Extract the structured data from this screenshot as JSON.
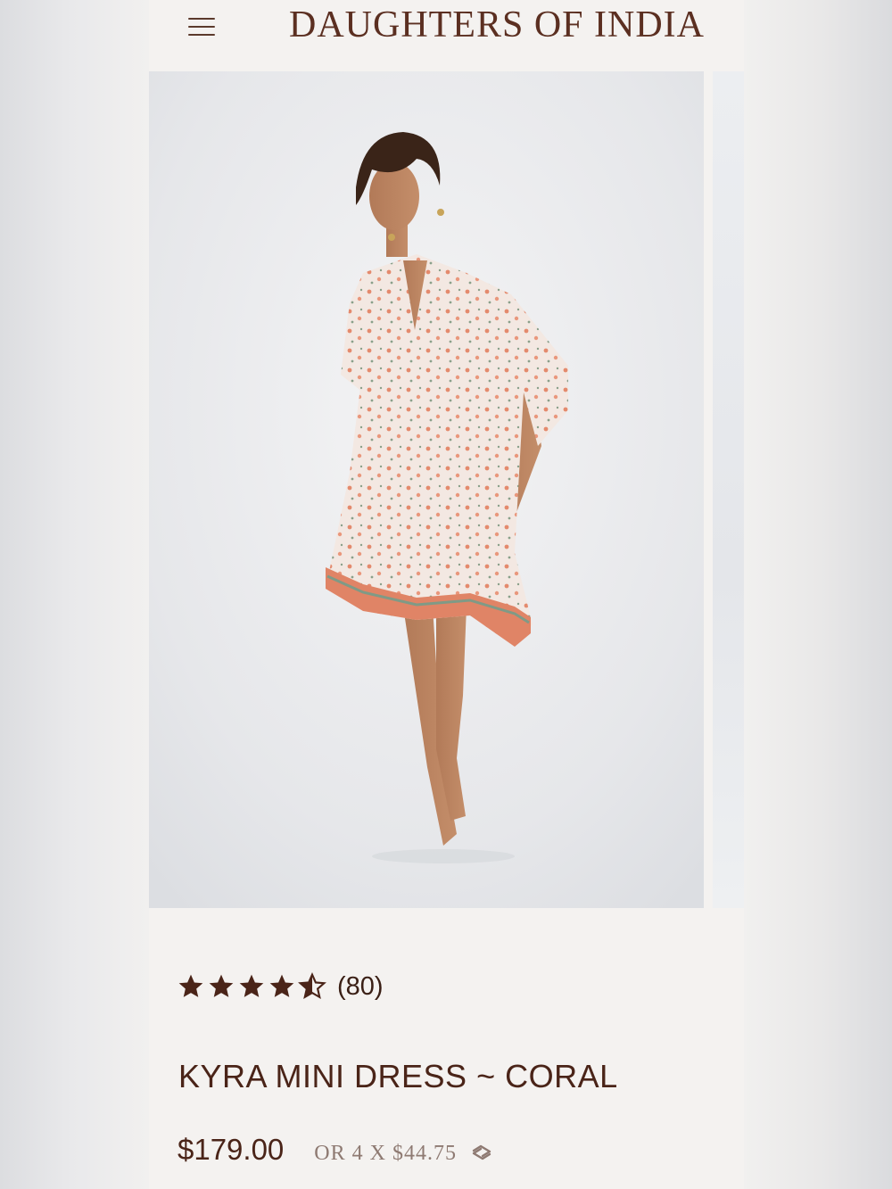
{
  "header": {
    "brand": "DAUGHTERS OF INDIA",
    "menu_icon": "hamburger-menu-icon"
  },
  "gallery": {
    "image_alt": "Model wearing floral coral mini dress"
  },
  "product": {
    "rating": 4.5,
    "rating_max": 5,
    "review_count": "(80)",
    "title": "KYRA MINI DRESS ~ CORAL",
    "price": "$179.00",
    "installment": "OR 4 X $44.75",
    "installment_icon": "afterpay-icon"
  },
  "colors": {
    "brand": "#5b2f21",
    "star": "#4a2418",
    "background": "#f4f2f0"
  }
}
